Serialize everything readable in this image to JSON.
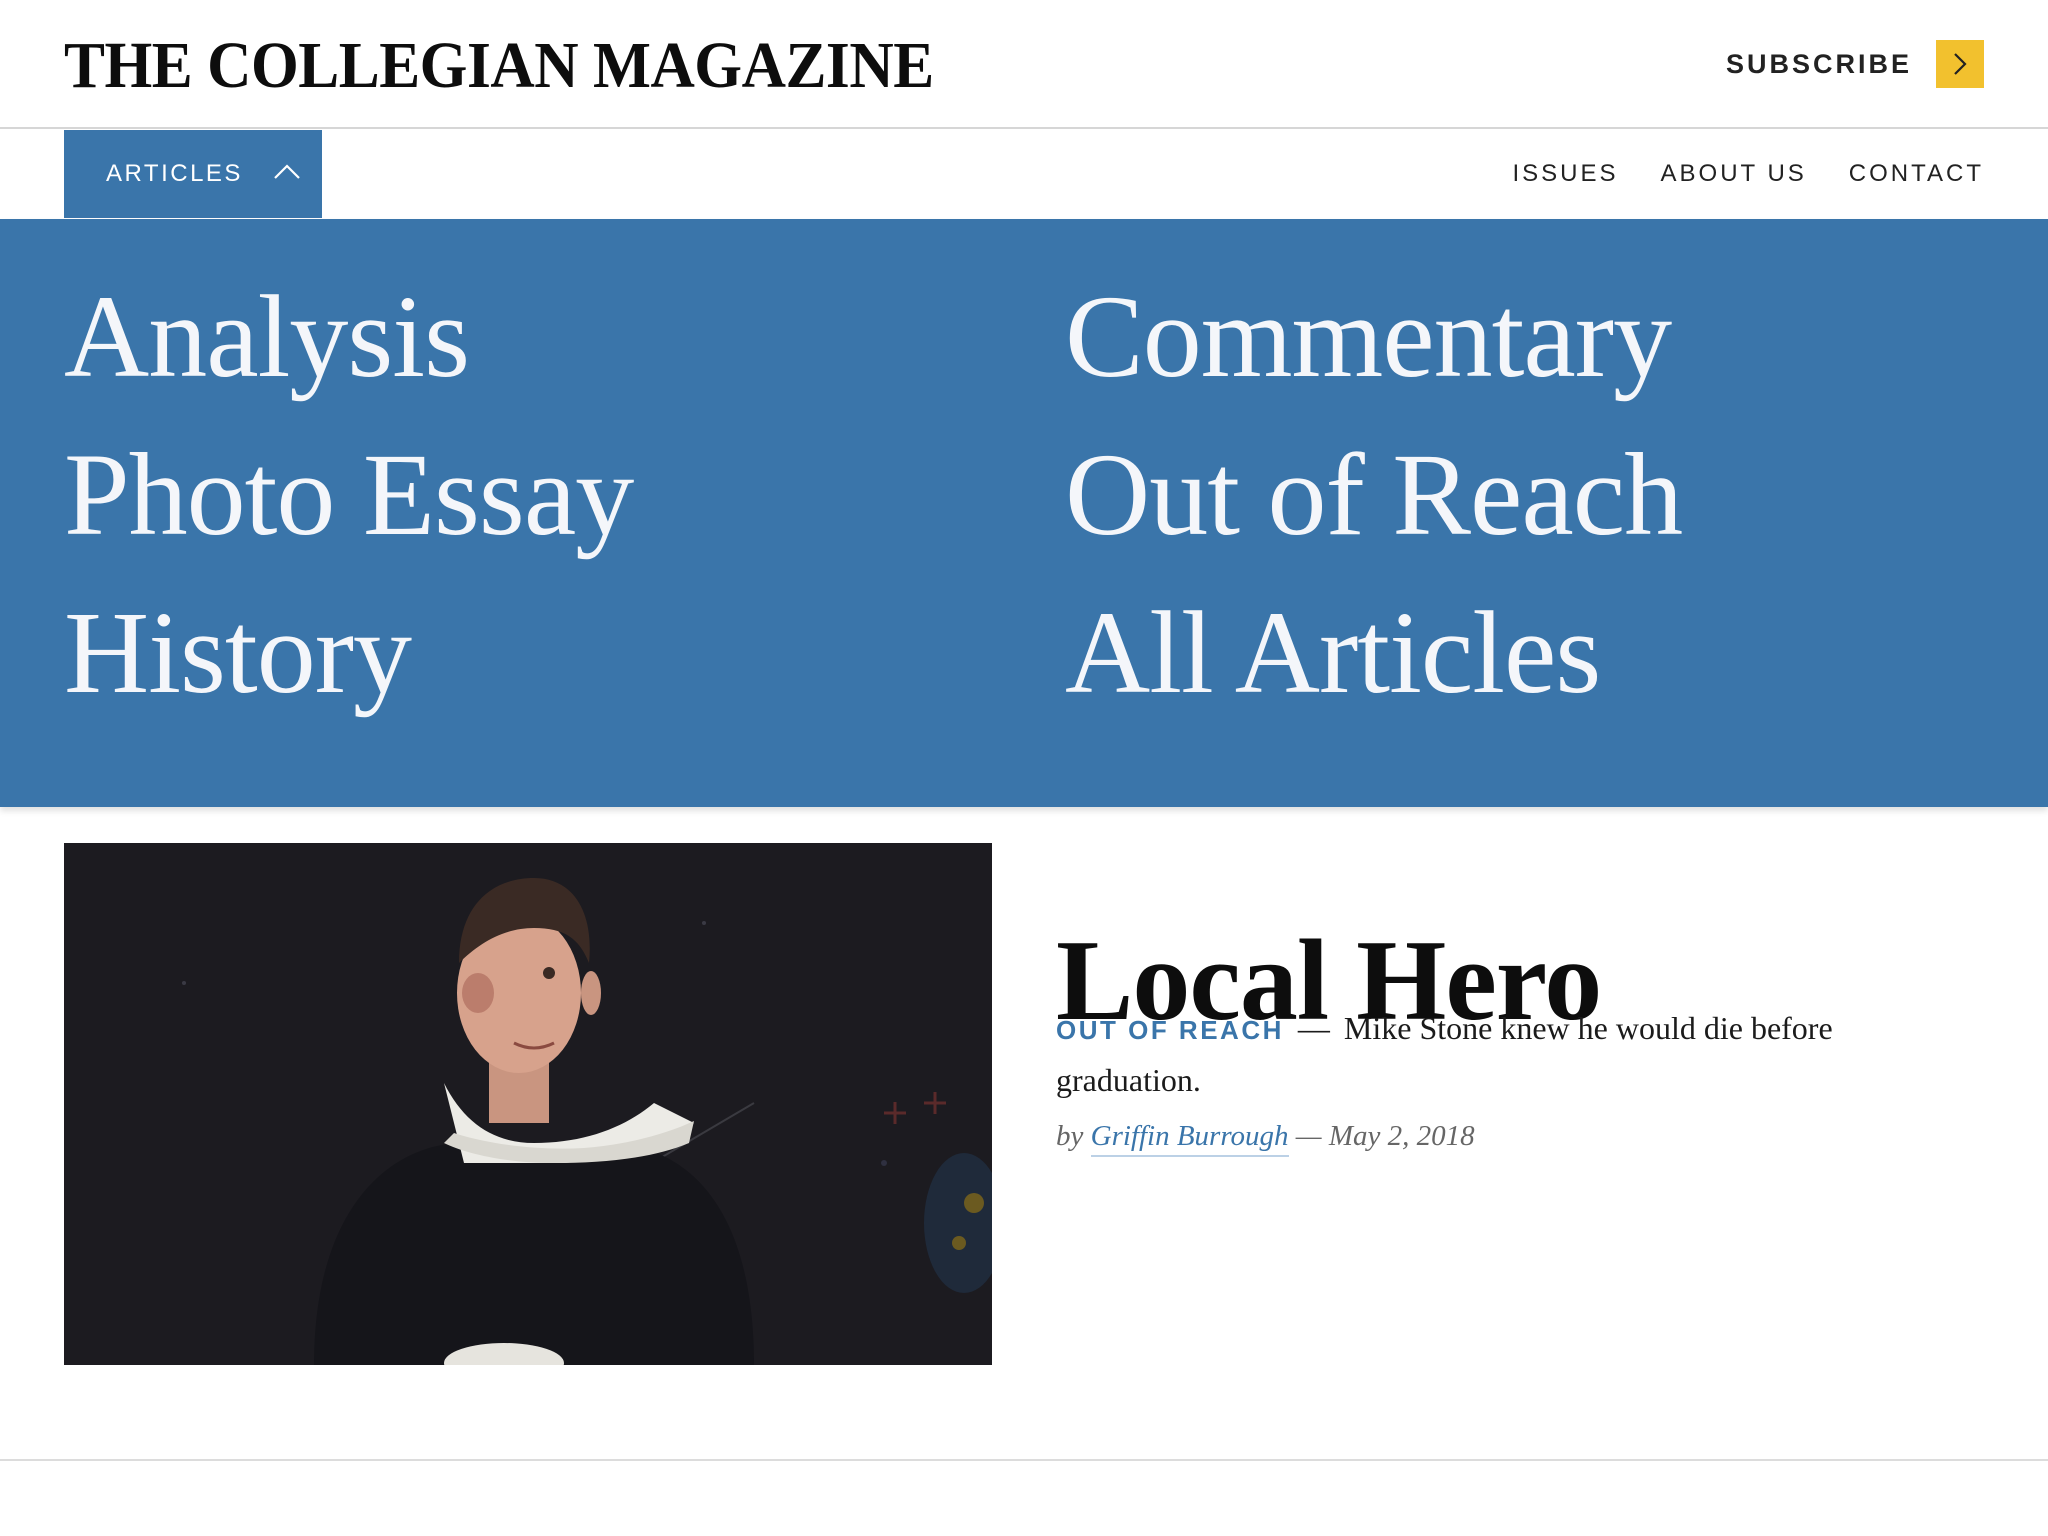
{
  "site": {
    "title": "THE COLLEGIAN MAGAZINE",
    "subscribe_label": "SUBSCRIBE"
  },
  "nav": {
    "articles_label": "ARTICLES",
    "links": [
      "ISSUES",
      "ABOUT US",
      "CONTACT"
    ]
  },
  "articles_menu": {
    "left": [
      "Analysis",
      "Photo Essay",
      "History"
    ],
    "right": [
      "Commentary",
      "Out of Reach",
      "All Articles"
    ]
  },
  "featured": {
    "title": "Local Hero",
    "category": "OUT OF REACH",
    "dash": "—",
    "summary": "Mike Stone knew he would die before graduation.",
    "by": "by",
    "author": "Griffin Burrough",
    "date": "— May 2, 2018"
  },
  "colors": {
    "accent_blue": "#3a75aa",
    "subscribe_yellow": "#f2c12e",
    "text": "#111111"
  },
  "icons": {
    "subscribe_arrow": "chevron-right-icon",
    "articles_toggle": "chevron-up-icon"
  }
}
